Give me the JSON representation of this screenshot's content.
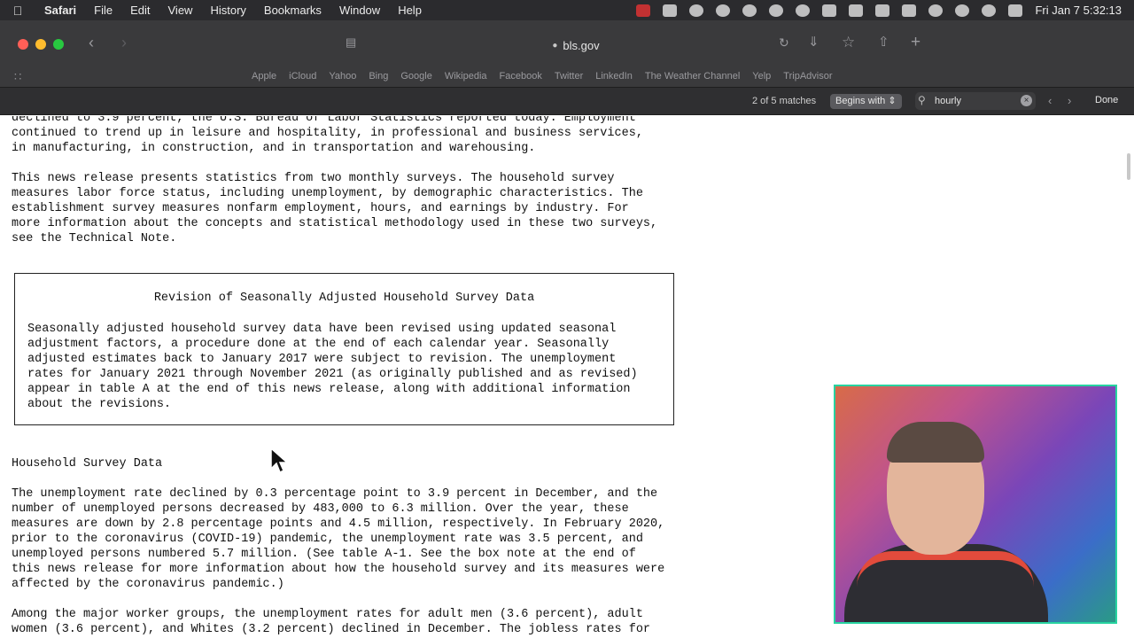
{
  "menubar": {
    "app_name": "Safari",
    "menus": [
      "File",
      "Edit",
      "View",
      "History",
      "Bookmarks",
      "Window",
      "Help"
    ],
    "clock": "Fri Jan 7  5:32:13"
  },
  "toolbar": {
    "url": "bls.gov"
  },
  "favorites": [
    "Apple",
    "iCloud",
    "Yahoo",
    "Bing",
    "Google",
    "Wikipedia",
    "Facebook",
    "Twitter",
    "LinkedIn",
    "The Weather Channel",
    "Yelp",
    "TripAdvisor"
  ],
  "findbar": {
    "match_count": "2 of 5 matches",
    "mode": "Begins with",
    "query": "hourly",
    "done_label": "Done"
  },
  "content": {
    "intro_lines": [
      "declined to 3.9 percent, the U.S. Bureau of Labor Statistics reported today. Employment",
      "continued to trend up in leisure and hospitality, in professional and business services,",
      "in manufacturing, in construction, and in transportation and warehousing."
    ],
    "para2_lines": [
      "This news release presents statistics from two monthly surveys. The household survey",
      "measures labor force status, including unemployment, by demographic characteristics. The",
      "establishment survey measures nonfarm employment, hours, and earnings by industry. For",
      "more information about the concepts and statistical methodology used in these two surveys,",
      "see the Technical Note."
    ],
    "box_title": "Revision of Seasonally Adjusted Household Survey Data",
    "box_lines": [
      "Seasonally adjusted household survey data have been revised using updated seasonal",
      "adjustment factors, a procedure done at the end of each calendar year. Seasonally",
      "adjusted estimates back to January 2017 were subject to revision. The unemployment",
      "rates for January 2021 through November 2021 (as originally published and as revised)",
      "appear in table A at the end of this news release, along with additional information",
      "about the revisions."
    ],
    "section_heading": "Household Survey Data",
    "para3_lines": [
      "The unemployment rate declined by 0.3 percentage point to 3.9 percent in December, and the",
      "number of unemployed persons decreased by 483,000 to 6.3 million. Over the year, these",
      "measures are down by 2.8 percentage points and 4.5 million, respectively. In February 2020,",
      "prior to the coronavirus (COVID-19) pandemic, the unemployment rate was 3.5 percent, and",
      "unemployed persons numbered 5.7 million. (See table A-1. See the box note at the end of",
      "this news release for more information about how the household survey and its measures were",
      "affected by the coronavirus pandemic.)"
    ],
    "para4_lines": [
      "Among the major worker groups, the unemployment rates for adult men (3.6 percent), adult",
      "women (3.6 percent), and Whites (3.2 percent) declined in December. The jobless rates for"
    ]
  }
}
